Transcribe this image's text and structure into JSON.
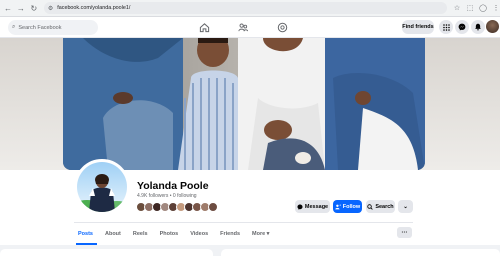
{
  "browser": {
    "url": "facebook.com/yolanda.poole1/",
    "nav_back": "←",
    "nav_forward": "→",
    "nav_reload": "↻",
    "tune": "⚙"
  },
  "fb": {
    "logo": "f",
    "search_placeholder": "Search Facebook",
    "find_friends": "Find friends"
  },
  "profile": {
    "name": "Yolanda Poole",
    "stats": "4.9K followers • 0 following",
    "friend_avatar_colors": [
      "#6b4e3d",
      "#8d6e63",
      "#3e2723",
      "#a1887f",
      "#5d4037",
      "#c49a7e",
      "#4e342e",
      "#795548",
      "#9e7b6a",
      "#6d4c41"
    ]
  },
  "actions": {
    "message": "Message",
    "follow": "Follow",
    "search": "Search",
    "more": "⌄"
  },
  "tabs": [
    {
      "label": "Posts",
      "active": true
    },
    {
      "label": "About",
      "active": false
    },
    {
      "label": "Reels",
      "active": false
    },
    {
      "label": "Photos",
      "active": false
    },
    {
      "label": "Videos",
      "active": false
    },
    {
      "label": "Friends",
      "active": false
    },
    {
      "label": "More ▾",
      "active": false
    }
  ],
  "tabs_more": "···",
  "colors": {
    "brand": "#0866ff",
    "gray_button": "#e4e6eb",
    "page_bg": "#f0f2f5"
  }
}
